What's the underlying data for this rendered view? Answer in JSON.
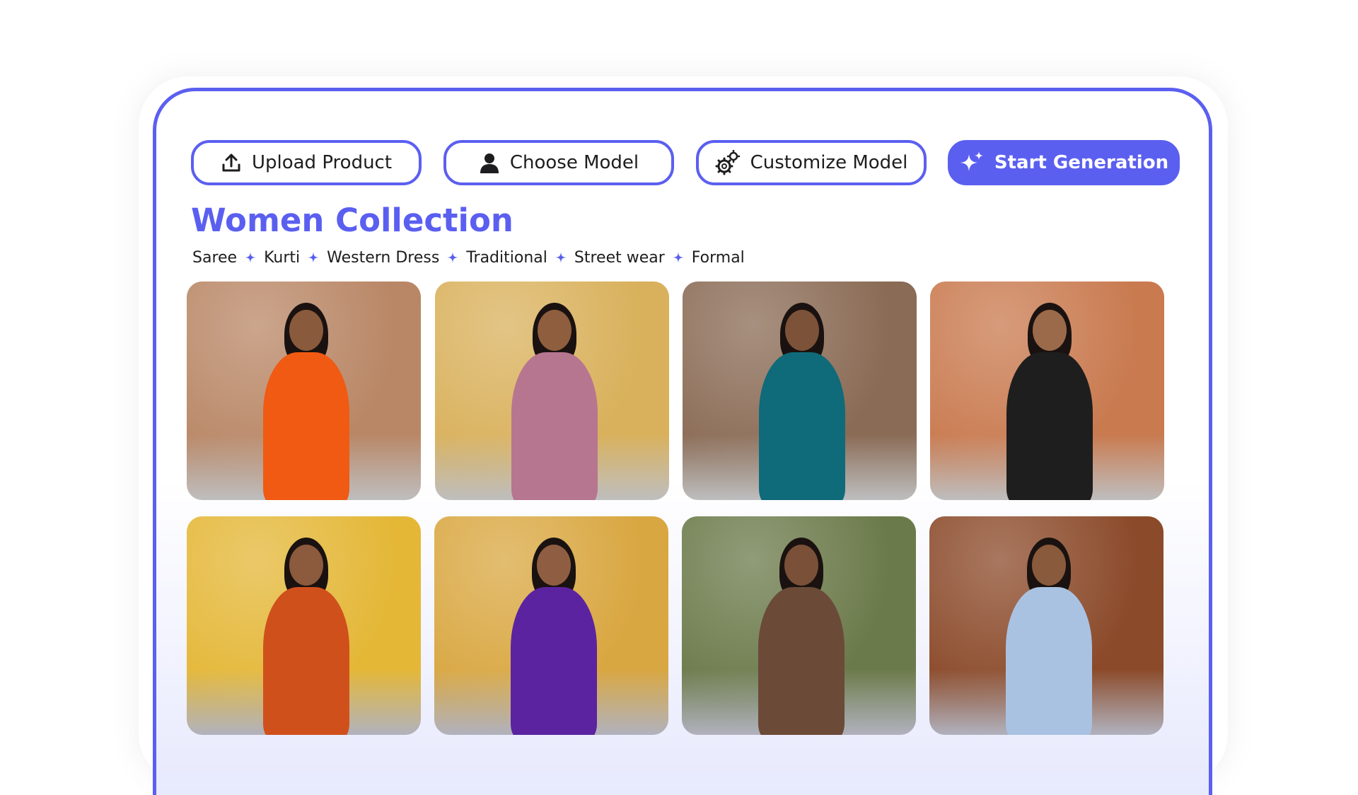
{
  "toolbar": {
    "upload_label": "Upload Product",
    "choose_label": "Choose Model",
    "customize_label": "Customize Model",
    "start_label": "Start Generation"
  },
  "collection": {
    "title": "Women Collection",
    "categories": [
      "Saree",
      "Kurti",
      "Western Dress",
      "Traditional",
      "Street wear",
      "Formal"
    ]
  },
  "gallery": [
    {
      "name": "orange-saree-photo",
      "bg": "#b98766",
      "outfit": "#f05a12",
      "skin": "#8a5a3c"
    },
    {
      "name": "pink-saree-photo",
      "bg": "#d9b15c",
      "outfit": "#b7768f",
      "skin": "#8f5e3e"
    },
    {
      "name": "teal-kurti-photo",
      "bg": "#8a6b55",
      "outfit": "#0f6a7a",
      "skin": "#7c5238"
    },
    {
      "name": "black-kurti-photo",
      "bg": "#c97a4f",
      "outfit": "#1e1e1e",
      "skin": "#9b6a4a"
    },
    {
      "name": "orange-lehenga-photo",
      "bg": "#e4b737",
      "outfit": "#d0501c",
      "skin": "#8c5a3c"
    },
    {
      "name": "purple-dress-photo",
      "bg": "#d9a741",
      "outfit": "#5b23a0",
      "skin": "#8f5e42"
    },
    {
      "name": "brown-shirt-photo",
      "bg": "#6b7a4a",
      "outfit": "#6b4a38",
      "skin": "#7a5038"
    },
    {
      "name": "formal-shirt-photo",
      "bg": "#8b4a2a",
      "outfit": "#a9c2e2",
      "skin": "#8a5a3c"
    }
  ],
  "colors": {
    "accent": "#5b5ff0",
    "text": "#1d1d1f"
  }
}
